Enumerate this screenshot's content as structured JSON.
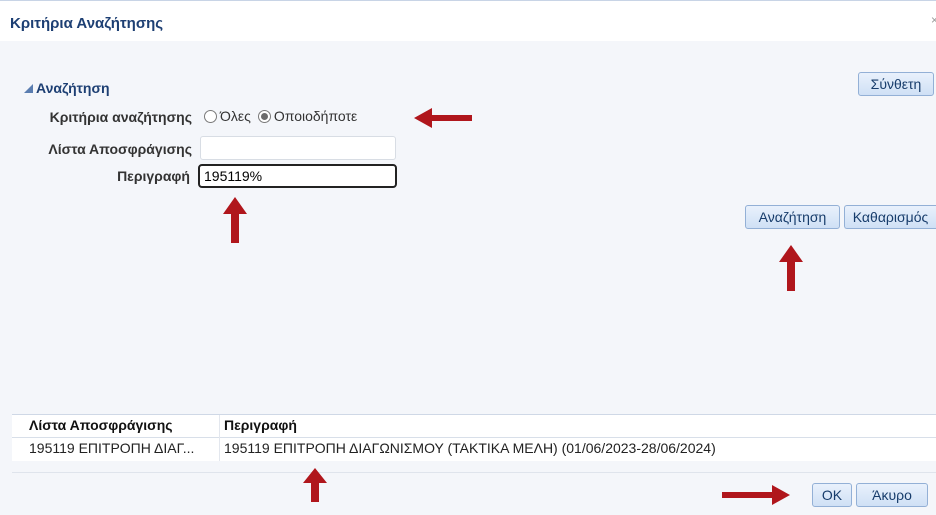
{
  "dialog": {
    "title": "Κριτήρια Αναζήτησης"
  },
  "search": {
    "section_title": "Αναζήτηση",
    "advanced_button": "Σύνθετη",
    "criteria_label": "Κριτήρια αναζήτησης",
    "radio_all": "Όλες",
    "radio_any": "Οποιοδήποτε",
    "list_label": "Λίστα Αποσφράγισης",
    "list_value": "",
    "description_label": "Περιγραφή",
    "description_value": "195119%",
    "search_button": "Αναζήτηση",
    "clear_button": "Καθαρισμός"
  },
  "results": {
    "columns": [
      "Λίστα Αποσφράγισης",
      "Περιγραφή"
    ],
    "rows": [
      [
        "195119 ΕΠΙΤΡΟΠΗ ΔΙΑΓ...",
        "195119 ΕΠΙΤΡΟΠΗ ΔΙΑΓΩΝΙΣΜΟΥ (ΤΑΚΤΙΚΑ ΜΕΛΗ) (01/06/2023-28/06/2024)"
      ]
    ]
  },
  "footer": {
    "ok_button": "OK",
    "cancel_button": "Άκυρο"
  },
  "colors": {
    "annotation_arrow": "#b0161c",
    "title": "#1d3f73"
  }
}
